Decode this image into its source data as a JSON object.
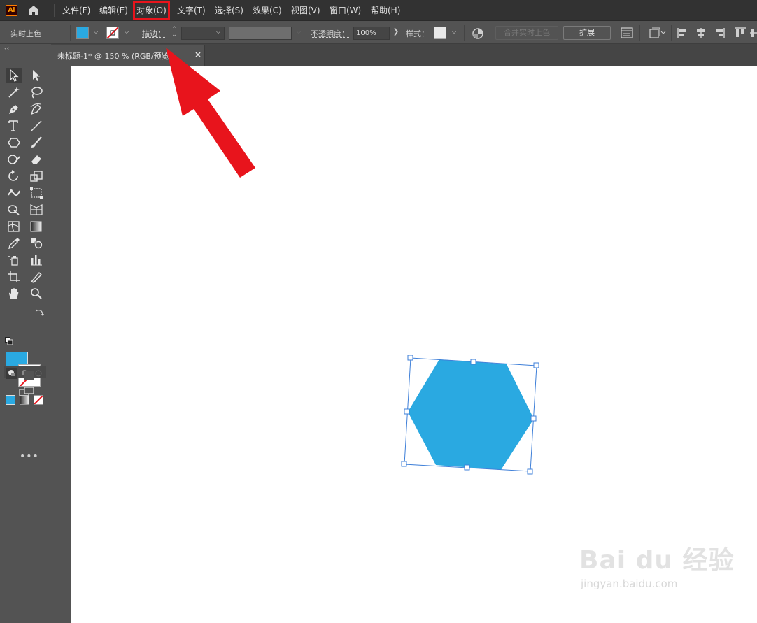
{
  "app": {
    "logo_text": "Ai"
  },
  "menu": {
    "items": [
      {
        "label": "文件(F)"
      },
      {
        "label": "编辑(E)"
      },
      {
        "label": "对象(O)"
      },
      {
        "label": "文字(T)"
      },
      {
        "label": "选择(S)"
      },
      {
        "label": "效果(C)"
      },
      {
        "label": "视图(V)"
      },
      {
        "label": "窗口(W)"
      },
      {
        "label": "帮助(H)"
      }
    ],
    "highlighted_item": "对象(O)"
  },
  "controlbar": {
    "live_paint_label": "实时上色",
    "stroke_label": "描边：",
    "opacity_label": "不透明度：",
    "opacity_value": "100%",
    "style_label": "样式：",
    "merge_button": "合并实时上色",
    "expand_button": "扩展",
    "fill_color": "#2aa9e1"
  },
  "document": {
    "tab_title": "未标题-1* @ 150 % (RGB/预览)",
    "close_glyph": "×"
  },
  "toolbar": {
    "collapse_glyph": "‹‹",
    "more_glyph": "•••",
    "fill_color": "#2aa9e1",
    "stroke": "none"
  },
  "shape": {
    "type": "hexagon",
    "fill": "#2aa9e1",
    "state": "selected"
  },
  "annotation": {
    "arrow_color": "#e8141c"
  },
  "watermark": {
    "main": "Bai du 经验",
    "sub": "jingyan.baidu.com"
  }
}
